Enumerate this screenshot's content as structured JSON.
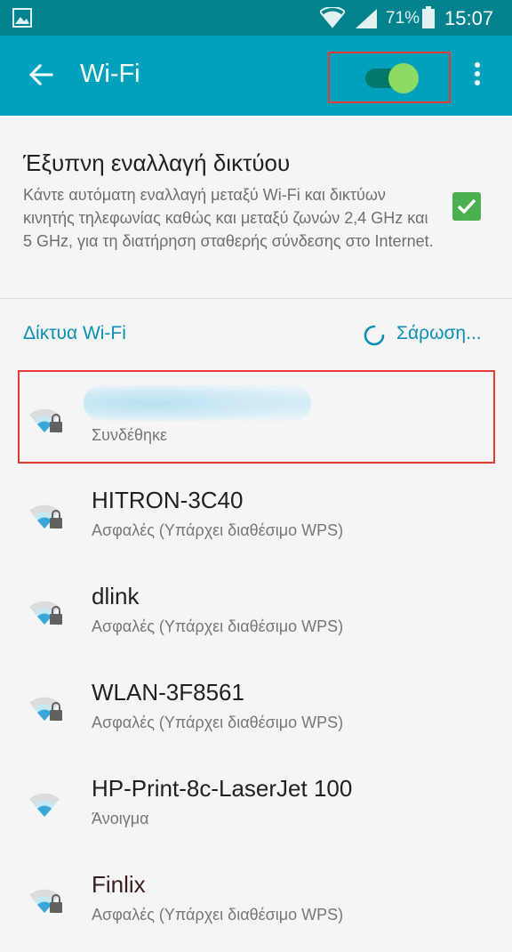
{
  "status_bar": {
    "battery": "71%",
    "time": "15:07"
  },
  "app_bar": {
    "title": "Wi-Fi",
    "wifi_toggle_on": true
  },
  "smart_switch": {
    "title": "Έξυπνη εναλλαγή δικτύου",
    "description": "Κάντε αυτόματη εναλλαγή μεταξύ Wi-Fi και δικτύων κινητής τηλεφωνίας καθώς και μεταξύ ζωνών 2,4 GHz και 5 GHz, για τη διατήρηση σταθερής σύνδεσης στο Internet.",
    "checked": true
  },
  "networks": {
    "header": "Δίκτυα Wi-Fi",
    "scan_label": "Σάρωση...",
    "items": [
      {
        "name": "",
        "status": "Συνδέθηκε",
        "secured": true
      },
      {
        "name": "HITRON-3C40",
        "status": "Ασφαλές (Υπάρχει διαθέσιμο WPS)",
        "secured": true
      },
      {
        "name": "dlink",
        "status": "Ασφαλές (Υπάρχει διαθέσιμο WPS)",
        "secured": true
      },
      {
        "name": "WLAN-3F8561",
        "status": "Ασφαλές (Υπάρχει διαθέσιμο WPS)",
        "secured": true
      },
      {
        "name": "HP-Print-8c-LaserJet 100",
        "status": "Άνοιγμα",
        "secured": false
      },
      {
        "name": "Finlix",
        "status": "Ασφαλές (Υπάρχει διαθέσιμο WPS)",
        "secured": true
      }
    ]
  },
  "colors": {
    "status_bar": "#00838f",
    "app_bar": "#00a1bd",
    "accent": "#0a8fb5",
    "checkbox": "#4caf50",
    "toggle_thumb": "#8cdb63",
    "highlight_frame": "#e53935"
  }
}
